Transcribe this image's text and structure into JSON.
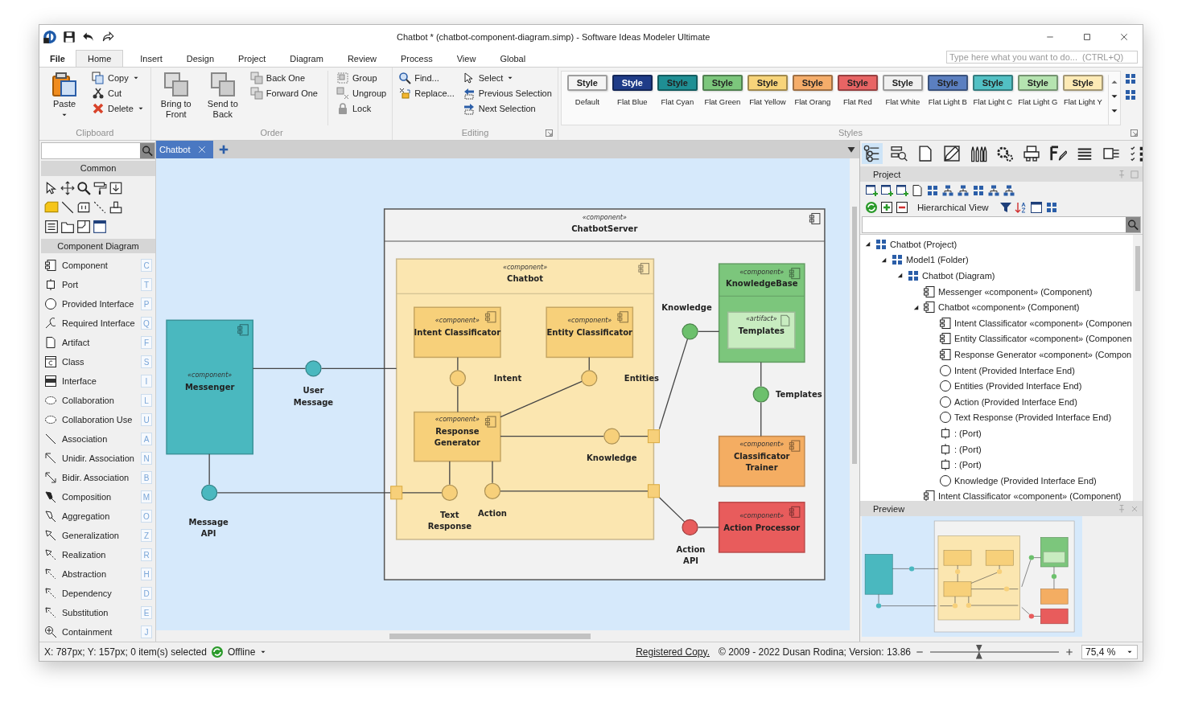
{
  "window": {
    "title": "Chatbot *  (chatbot-component-diagram.simp) - Software Ideas Modeler Ultimate"
  },
  "menu_tabs": [
    {
      "label": "File",
      "selected": false
    },
    {
      "label": "Home",
      "selected": true
    },
    {
      "label": "Insert",
      "selected": false
    },
    {
      "label": "Design",
      "selected": false
    },
    {
      "label": "Project",
      "selected": false
    },
    {
      "label": "Diagram",
      "selected": false
    },
    {
      "label": "Review",
      "selected": false
    },
    {
      "label": "Process",
      "selected": false
    },
    {
      "label": "View",
      "selected": false
    },
    {
      "label": "Global",
      "selected": false
    }
  ],
  "command_search": {
    "placeholder": "Type here what you want to do...  (CTRL+Q)"
  },
  "ribbon": {
    "groups": [
      {
        "title": "Clipboard",
        "columns": [
          [
            {
              "label": "Paste",
              "kind": "large",
              "dropdown": true
            }
          ],
          [
            {
              "label": "Copy",
              "kind": "small",
              "dropdown": true
            },
            {
              "label": "Cut",
              "kind": "small",
              "dropdown": false
            },
            {
              "label": "Delete",
              "kind": "small",
              "dropdown": true
            }
          ]
        ]
      },
      {
        "title": "Order",
        "columns": [
          [
            {
              "label": "Bring to Front",
              "kind": "large",
              "dropdown": false
            }
          ],
          [
            {
              "label": "Send to Back",
              "kind": "large",
              "dropdown": false
            }
          ],
          [
            {
              "label": "Back One",
              "kind": "small",
              "dropdown": false
            },
            {
              "label": "Forward One",
              "kind": "small",
              "dropdown": false
            }
          ],
          [
            {
              "label": "Group",
              "kind": "small",
              "dropdown": false
            },
            {
              "label": "Ungroup",
              "kind": "small",
              "dropdown": false
            },
            {
              "label": "Lock",
              "kind": "small",
              "dropdown": false
            }
          ]
        ]
      },
      {
        "title": "Editing",
        "columns": [
          [
            {
              "label": "Find...",
              "kind": "small",
              "dropdown": false
            },
            {
              "label": "Replace...",
              "kind": "small",
              "dropdown": false
            }
          ],
          [
            {
              "label": "Select",
              "kind": "small",
              "dropdown": true
            },
            {
              "label": "Previous Selection",
              "kind": "small",
              "dropdown": false
            },
            {
              "label": "Next Selection",
              "kind": "small",
              "dropdown": false
            }
          ]
        ]
      }
    ]
  },
  "styles": {
    "title": "Styles",
    "items": [
      {
        "label": "Default",
        "text": "Style",
        "color": "#f4f4f4"
      },
      {
        "label": "Flat Blue",
        "text": "Style",
        "color": "#1f3c88"
      },
      {
        "label": "Flat Cyan",
        "text": "Style",
        "color": "#1f8f94"
      },
      {
        "label": "Flat Green",
        "text": "Style",
        "color": "#7cc67c"
      },
      {
        "label": "Flat Yellow",
        "text": "Style",
        "color": "#f7d47a"
      },
      {
        "label": "Flat Orang",
        "text": "Style",
        "color": "#f5ad6a"
      },
      {
        "label": "Flat Red",
        "text": "Style",
        "color": "#e86464"
      },
      {
        "label": "Flat White",
        "text": "Style",
        "color": "#f0f0f0"
      },
      {
        "label": "Flat  Light B",
        "text": "Style",
        "color": "#5b7fc0"
      },
      {
        "label": "Flat  Light C",
        "text": "Style",
        "color": "#52c0c4"
      },
      {
        "label": "Flat  Light G",
        "text": "Style",
        "color": "#b5e3b0"
      },
      {
        "label": "Flat  Light Y",
        "text": "Style",
        "color": "#fdeab5"
      }
    ]
  },
  "toolbox": {
    "common": {
      "title": "Common"
    },
    "component_diagram": {
      "title": "Component Diagram",
      "items": [
        {
          "label": "Component",
          "key": "C"
        },
        {
          "label": "Port",
          "key": "T"
        },
        {
          "label": "Provided Interface",
          "key": "P"
        },
        {
          "label": "Required  Interface",
          "key": "Q"
        },
        {
          "label": "Artifact",
          "key": "F"
        },
        {
          "label": "Class",
          "key": "S"
        },
        {
          "label": "Interface",
          "key": "I"
        },
        {
          "label": "Collaboration",
          "key": "L"
        },
        {
          "label": "Collaboration Use",
          "key": "U"
        },
        {
          "label": "Association",
          "key": "A"
        },
        {
          "label": "Unidir. Association",
          "key": "N"
        },
        {
          "label": "Bidir. Association",
          "key": "B"
        },
        {
          "label": "Composition",
          "key": "M"
        },
        {
          "label": "Aggregation",
          "key": "O"
        },
        {
          "label": "Generalization",
          "key": "Z"
        },
        {
          "label": "Realization",
          "key": "R"
        },
        {
          "label": "Abstraction",
          "key": "H"
        },
        {
          "label": "Dependency",
          "key": "D"
        },
        {
          "label": "Substitution",
          "key": "E"
        },
        {
          "label": "Containment",
          "key": "J"
        }
      ]
    }
  },
  "document_tabs": [
    {
      "label": "Chatbot",
      "selected": true
    }
  ],
  "diagram": {
    "nodes": [
      {
        "kind": "component",
        "stereotype": "«component»",
        "name": "ChatbotServer",
        "color": "#f2f2f2"
      },
      {
        "kind": "component",
        "stereotype": "«component»",
        "name": "Chatbot",
        "color": "#fbe6b0"
      },
      {
        "kind": "component",
        "stereotype": "«component»",
        "name": "Messenger",
        "color": "#4ab8bf"
      },
      {
        "kind": "component",
        "stereotype": "«component»",
        "name": "Intent Classificator",
        "color": "#f7d07a"
      },
      {
        "kind": "component",
        "stereotype": "«component»",
        "name": "Entity Classificator",
        "color": "#f7d07a"
      },
      {
        "kind": "component",
        "stereotype": "«component»",
        "name": "Response Generator",
        "color": "#f7d07a"
      },
      {
        "kind": "component",
        "stereotype": "«component»",
        "name": "KnowledgeBase",
        "color": "#7cc67c"
      },
      {
        "kind": "artifact",
        "stereotype": "«artifact»",
        "name": "Templates",
        "color": "#c8ecc0"
      },
      {
        "kind": "component",
        "stereotype": "«component»",
        "name": "Classificator Trainer",
        "color": "#f4ad62"
      },
      {
        "kind": "component",
        "stereotype": "«component»",
        "name": "Action Processor",
        "color": "#e85c5c"
      }
    ],
    "interfaces": [
      {
        "label": "User Message",
        "color": "#4ab8bf"
      },
      {
        "label": "Message API",
        "color": "#4ab8bf"
      },
      {
        "label": "Intent",
        "color": "#f7d07a"
      },
      {
        "label": "Entities",
        "color": "#f7d07a"
      },
      {
        "label": "Knowledge",
        "color": "#f7d07a"
      },
      {
        "label": "Text Response",
        "color": "#f7d07a"
      },
      {
        "label": "Action",
        "color": "#f7d07a"
      },
      {
        "label": "Knowledge",
        "color": "#6cc06c"
      },
      {
        "label": "Templates",
        "color": "#6cc06c"
      },
      {
        "label": "Action API",
        "color": "#e85c5c"
      }
    ]
  },
  "right_panel": {
    "tools": [
      {
        "selected": true
      },
      {
        "selected": false
      },
      {
        "selected": false
      },
      {
        "selected": false
      },
      {
        "selected": false
      },
      {
        "selected": false
      },
      {
        "selected": false
      },
      {
        "selected": false
      },
      {
        "selected": false
      },
      {
        "selected": false
      },
      {
        "selected": false
      }
    ],
    "project": {
      "title": "Project",
      "view": "Hierarchical View",
      "tree": [
        {
          "label": "Chatbot (Project)",
          "kind": "project",
          "expanded": true,
          "children": [
            {
              "label": "Model1 (Folder)",
              "kind": "folder",
              "expanded": true,
              "children": [
                {
                  "label": "Chatbot (Diagram)",
                  "kind": "diagram",
                  "expanded": true,
                  "children": [
                    {
                      "label": "Messenger «component» (Component)",
                      "kind": "component"
                    },
                    {
                      "label": "Chatbot «component» (Component)",
                      "kind": "component",
                      "expanded": true,
                      "children": [
                        {
                          "label": "Intent Classificator «component» (Componen",
                          "kind": "component"
                        },
                        {
                          "label": "Entity Classificator «component» (Componen",
                          "kind": "component"
                        },
                        {
                          "label": "Response Generator «component» (Compon",
                          "kind": "component"
                        },
                        {
                          "label": "Intent (Provided Interface End)",
                          "kind": "interface"
                        },
                        {
                          "label": "Entities (Provided Interface End)",
                          "kind": "interface"
                        },
                        {
                          "label": "Action (Provided Interface End)",
                          "kind": "interface"
                        },
                        {
                          "label": "Text Response (Provided Interface End)",
                          "kind": "interface"
                        },
                        {
                          "label": ":  (Port)",
                          "kind": "port"
                        },
                        {
                          "label": ":  (Port)",
                          "kind": "port"
                        },
                        {
                          "label": ":  (Port)",
                          "kind": "port"
                        },
                        {
                          "label": "Knowledge (Provided Interface End)",
                          "kind": "interface"
                        }
                      ]
                    },
                    {
                      "label": "Intent Classificator «component» (Component)",
                      "kind": "component"
                    }
                  ]
                }
              ]
            }
          ]
        }
      ]
    },
    "preview": {
      "title": "Preview"
    }
  },
  "status_bar": {
    "position": "X: 787px; Y: 157px; 0 item(s) selected",
    "connection": "Offline",
    "license": "Registered Copy.",
    "copyright": "© 2009 - 2022 Dusan Rodina; Version: 13.86",
    "zoom": {
      "level": 0.38,
      "value": "75,4 %"
    }
  }
}
